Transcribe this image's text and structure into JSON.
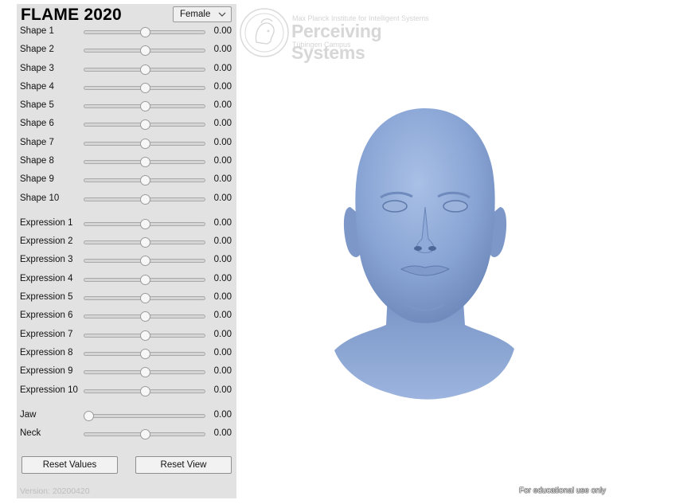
{
  "app": {
    "title": "FLAME 2020",
    "gender": {
      "selected": "Female"
    }
  },
  "sliders": {
    "shape": [
      {
        "label": "Shape 1",
        "value": "0.00",
        "level": 0.5
      },
      {
        "label": "Shape 2",
        "value": "0.00",
        "level": 0.5
      },
      {
        "label": "Shape 3",
        "value": "0.00",
        "level": 0.5
      },
      {
        "label": "Shape 4",
        "value": "0.00",
        "level": 0.5
      },
      {
        "label": "Shape 5",
        "value": "0.00",
        "level": 0.5
      },
      {
        "label": "Shape 6",
        "value": "0.00",
        "level": 0.5
      },
      {
        "label": "Shape 7",
        "value": "0.00",
        "level": 0.5
      },
      {
        "label": "Shape 8",
        "value": "0.00",
        "level": 0.5
      },
      {
        "label": "Shape 9",
        "value": "0.00",
        "level": 0.5
      },
      {
        "label": "Shape 10",
        "value": "0.00",
        "level": 0.5
      }
    ],
    "expression": [
      {
        "label": "Expression 1",
        "value": "0.00",
        "level": 0.5
      },
      {
        "label": "Expression 2",
        "value": "0.00",
        "level": 0.5
      },
      {
        "label": "Expression 3",
        "value": "0.00",
        "level": 0.5
      },
      {
        "label": "Expression 4",
        "value": "0.00",
        "level": 0.5
      },
      {
        "label": "Expression 5",
        "value": "0.00",
        "level": 0.5
      },
      {
        "label": "Expression 6",
        "value": "0.00",
        "level": 0.5
      },
      {
        "label": "Expression 7",
        "value": "0.00",
        "level": 0.5
      },
      {
        "label": "Expression 8",
        "value": "0.00",
        "level": 0.5
      },
      {
        "label": "Expression 9",
        "value": "0.00",
        "level": 0.5
      },
      {
        "label": "Expression 10",
        "value": "0.00",
        "level": 0.5
      }
    ],
    "pose": [
      {
        "label": "Jaw",
        "value": "0.00",
        "level": 0.0
      },
      {
        "label": "Neck",
        "value": "0.00",
        "level": 0.5
      }
    ]
  },
  "buttons": {
    "reset_values": "Reset Values",
    "reset_view": "Reset View"
  },
  "version": "Version: 20200420",
  "logo": {
    "line1": "Max Planck Institute for Intelligent Systems",
    "line2": "Perceiving Systems",
    "line3": "Tübingen Campus",
    "icon": "minerva-seal-icon"
  },
  "viewport": {
    "model_icon": "head-model",
    "model_color": "#8aa6d6"
  },
  "footer_note": "For educational use only",
  "colors": {
    "panel_bg": "#e2e2e2",
    "model": "#8aa6d6"
  }
}
